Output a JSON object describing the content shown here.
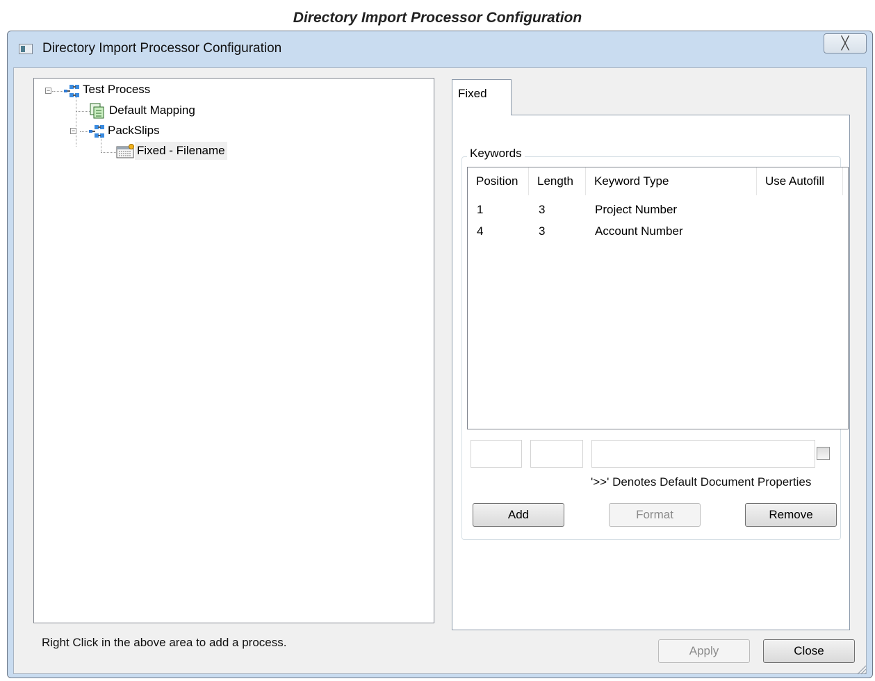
{
  "caption": "Directory Import Processor Configuration",
  "window": {
    "title": "Directory Import Processor Configuration",
    "close_glyph": "╳"
  },
  "tree": {
    "items": [
      {
        "label": "Test Process",
        "icon": "process-icon",
        "expanded": true
      },
      {
        "label": "Default Mapping",
        "icon": "mapping-icon"
      },
      {
        "label": "PackSlips",
        "icon": "process-icon",
        "expanded": true
      },
      {
        "label": "Fixed - Filename",
        "icon": "fixed-filename-icon",
        "selected": true
      }
    ]
  },
  "status_text": "Right Click in the above area to add a process.",
  "tab": {
    "label": "Fixed"
  },
  "keywords": {
    "group_label": "Keywords",
    "columns": [
      "Position",
      "Length",
      "Keyword Type",
      "Use Autofill"
    ],
    "rows": [
      {
        "position": "1",
        "length": "3",
        "keyword_type": "Project Number",
        "use_autofill": ""
      },
      {
        "position": "4",
        "length": "3",
        "keyword_type": "Account Number",
        "use_autofill": ""
      }
    ],
    "position_value": "",
    "length_value": "",
    "keyword_type_value": "",
    "autofill_checked": false,
    "note": "'>>' Denotes Default Document Properties",
    "add_label": "Add",
    "format_label": "Format",
    "remove_label": "Remove"
  },
  "footer": {
    "apply_label": "Apply",
    "close_label": "Close"
  },
  "colors": {
    "window_frame": "#c9dcf0",
    "client_bg": "#f0f0f0",
    "disabled_text": "#8b8b8b"
  }
}
